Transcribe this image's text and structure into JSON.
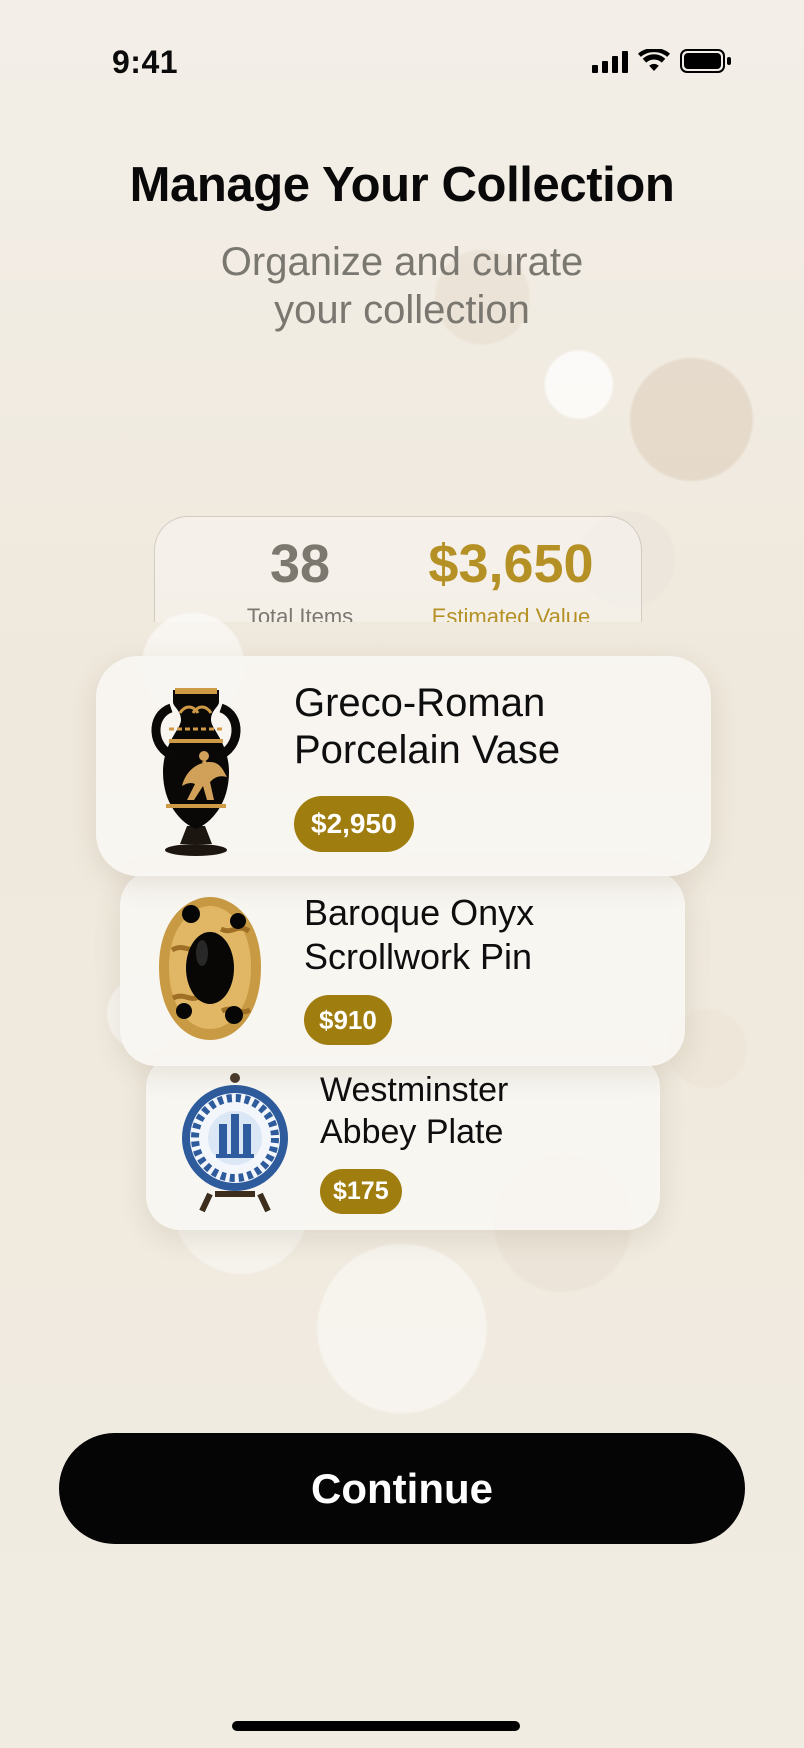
{
  "status_bar": {
    "time": "9:41"
  },
  "header": {
    "title": "Manage Your Collection",
    "subtitle_line1": "Organize and curate",
    "subtitle_line2": "your collection"
  },
  "stats": {
    "total_items": "38",
    "total_items_label": "Total Items",
    "estimated_value": "$3,650",
    "estimated_value_label": "Estimated Value"
  },
  "items": [
    {
      "title_line1": "Greco-Roman",
      "title_line2": "Porcelain Vase",
      "price": "$2,950",
      "icon": "greek-vase-icon"
    },
    {
      "title_line1": "Baroque Onyx",
      "title_line2": "Scrollwork Pin",
      "price": "$910",
      "icon": "onyx-brooch-icon"
    },
    {
      "title_line1": "Westminster",
      "title_line2": "Abbey Plate",
      "price": "$175",
      "icon": "decorative-plate-icon"
    }
  ],
  "actions": {
    "continue_label": "Continue"
  },
  "colors": {
    "background": "#f1ece2",
    "gold": "#b59125",
    "price_badge": "#a07d0f",
    "button": "#050505",
    "muted_text": "#7a7670"
  }
}
